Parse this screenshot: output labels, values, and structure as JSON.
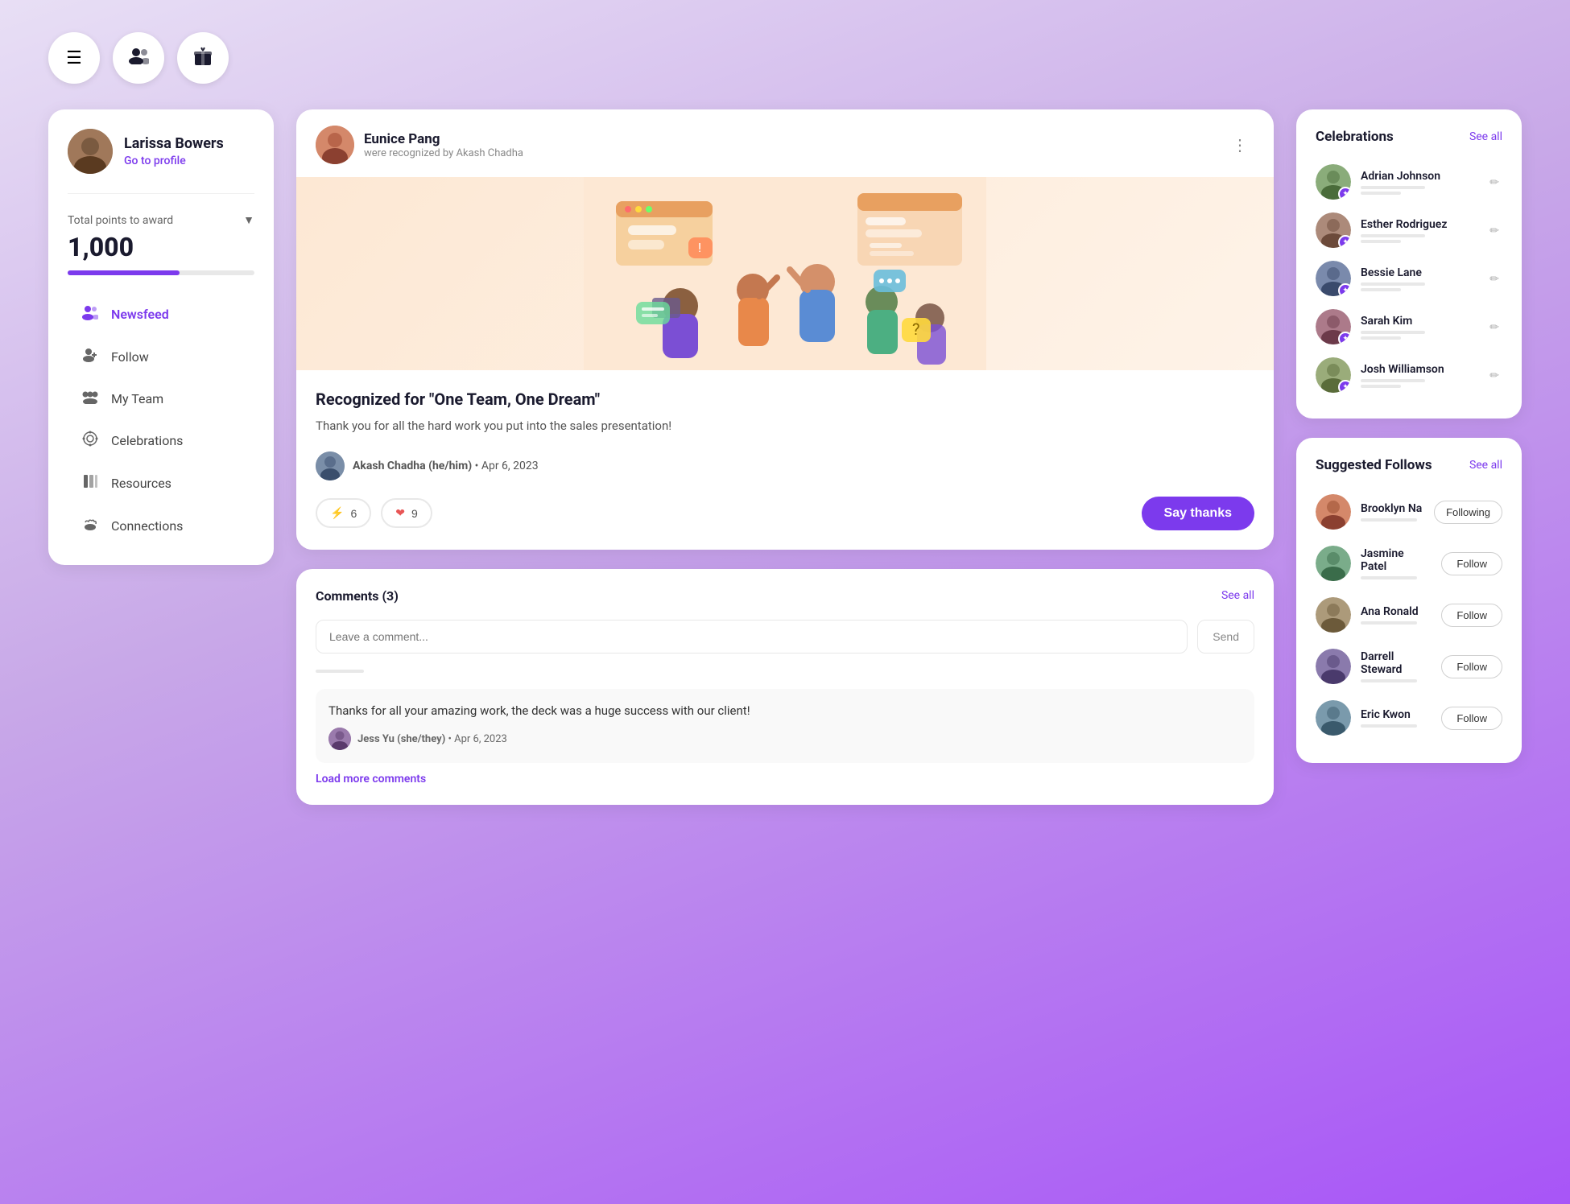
{
  "topNav": {
    "menuLabel": "≡",
    "peopleLabel": "👥",
    "giftLabel": "🎁"
  },
  "sidebar": {
    "user": {
      "name": "Larissa Bowers",
      "profileLink": "Go to profile",
      "avatarClass": "av-larissa"
    },
    "points": {
      "label": "Total points to award",
      "value": "1,000",
      "fillPercent": 60
    },
    "nav": [
      {
        "id": "newsfeed",
        "label": "Newsfeed",
        "icon": "👥",
        "active": true
      },
      {
        "id": "follow",
        "label": "Follow",
        "icon": "➕",
        "active": false
      },
      {
        "id": "myteam",
        "label": "My Team",
        "icon": "👪",
        "active": false
      },
      {
        "id": "celebrations",
        "label": "Celebrations",
        "icon": "🏅",
        "active": false
      },
      {
        "id": "resources",
        "label": "Resources",
        "icon": "📋",
        "active": false
      },
      {
        "id": "connections",
        "label": "Connections",
        "icon": "☕",
        "active": false
      }
    ]
  },
  "feed": {
    "post": {
      "user": "Eunice Pang",
      "subtitle": "were recognized by Akash Chadha",
      "title": "Recognized for \"One Team, One Dream\"",
      "body": "Thank you for all the hard work you put into the sales presentation!",
      "author": "Akash Chadha (he/him)",
      "date": "Apr 6, 2023",
      "reactions": {
        "lightning": 6,
        "heart": 9
      },
      "sayThanksLabel": "Say thanks"
    },
    "comments": {
      "title": "Comments (3)",
      "seeAll": "See all",
      "inputPlaceholder": "Leave a comment...",
      "sendLabel": "Send",
      "loadMore": "Load more comments",
      "items": [
        {
          "text": "Thanks for all your amazing work, the deck was a huge success with our client!",
          "author": "Jess Yu (she/they)",
          "date": "Apr 6, 2023"
        }
      ]
    }
  },
  "celebrations": {
    "title": "Celebrations",
    "seeAll": "See all",
    "items": [
      {
        "name": "Adrian Johnson",
        "avatarClass": "av-adrian"
      },
      {
        "name": "Esther Rodriguez",
        "avatarClass": "av-esther"
      },
      {
        "name": "Bessie Lane",
        "avatarClass": "av-bessie"
      },
      {
        "name": "Sarah Kim",
        "avatarClass": "av-sarah"
      },
      {
        "name": "Josh Williamson",
        "avatarClass": "av-josh"
      }
    ]
  },
  "suggestedFollows": {
    "title": "Suggested Follows",
    "seeAll": "See all",
    "items": [
      {
        "name": "Brooklyn Na",
        "avatarClass": "av-brooklyn",
        "status": "Following"
      },
      {
        "name": "Jasmine Patel",
        "avatarClass": "av-jasmine",
        "status": "Follow"
      },
      {
        "name": "Ana Ronald",
        "avatarClass": "av-ana",
        "status": "Follow"
      },
      {
        "name": "Darrell Steward",
        "avatarClass": "av-darrell",
        "status": "Follow"
      },
      {
        "name": "Eric Kwon",
        "avatarClass": "av-eric",
        "status": "Follow"
      }
    ]
  }
}
